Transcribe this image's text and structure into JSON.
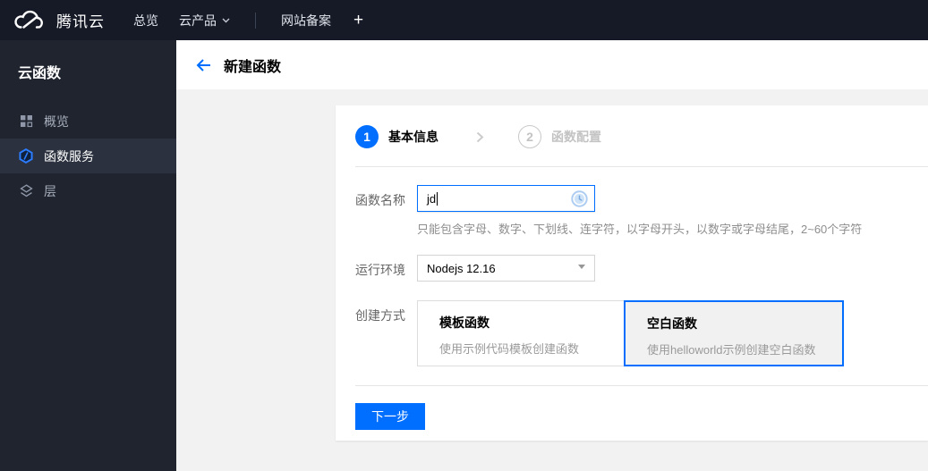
{
  "navbar": {
    "brand": "腾讯云",
    "items": [
      {
        "label": "总览"
      },
      {
        "label": "云产品"
      },
      {
        "label": "网站备案"
      }
    ],
    "plus_label": "+"
  },
  "sidebar": {
    "title": "云函数",
    "items": [
      {
        "label": "概览"
      },
      {
        "label": "函数服务"
      },
      {
        "label": "层"
      }
    ]
  },
  "header": {
    "title": "新建函数"
  },
  "wizard": {
    "steps": [
      {
        "num": "1",
        "label": "基本信息"
      },
      {
        "num": "2",
        "label": "函数配置"
      }
    ]
  },
  "form": {
    "name_label": "函数名称",
    "name_value": "jd",
    "name_help": "只能包含字母、数字、下划线、连字符，以字母开头，以数字或字母结尾，2~60个字符",
    "runtime_label": "运行环境",
    "runtime_value": "Nodejs 12.16",
    "method_label": "创建方式",
    "methods": [
      {
        "title": "模板函数",
        "desc": "使用示例代码模板创建函数"
      },
      {
        "title": "空白函数",
        "desc": "使用helloworld示例创建空白函数"
      }
    ],
    "next_label": "下一步"
  },
  "colors": {
    "accent": "#006eff",
    "navbar_bg": "#151a26",
    "sidebar_bg": "#1f242f"
  }
}
